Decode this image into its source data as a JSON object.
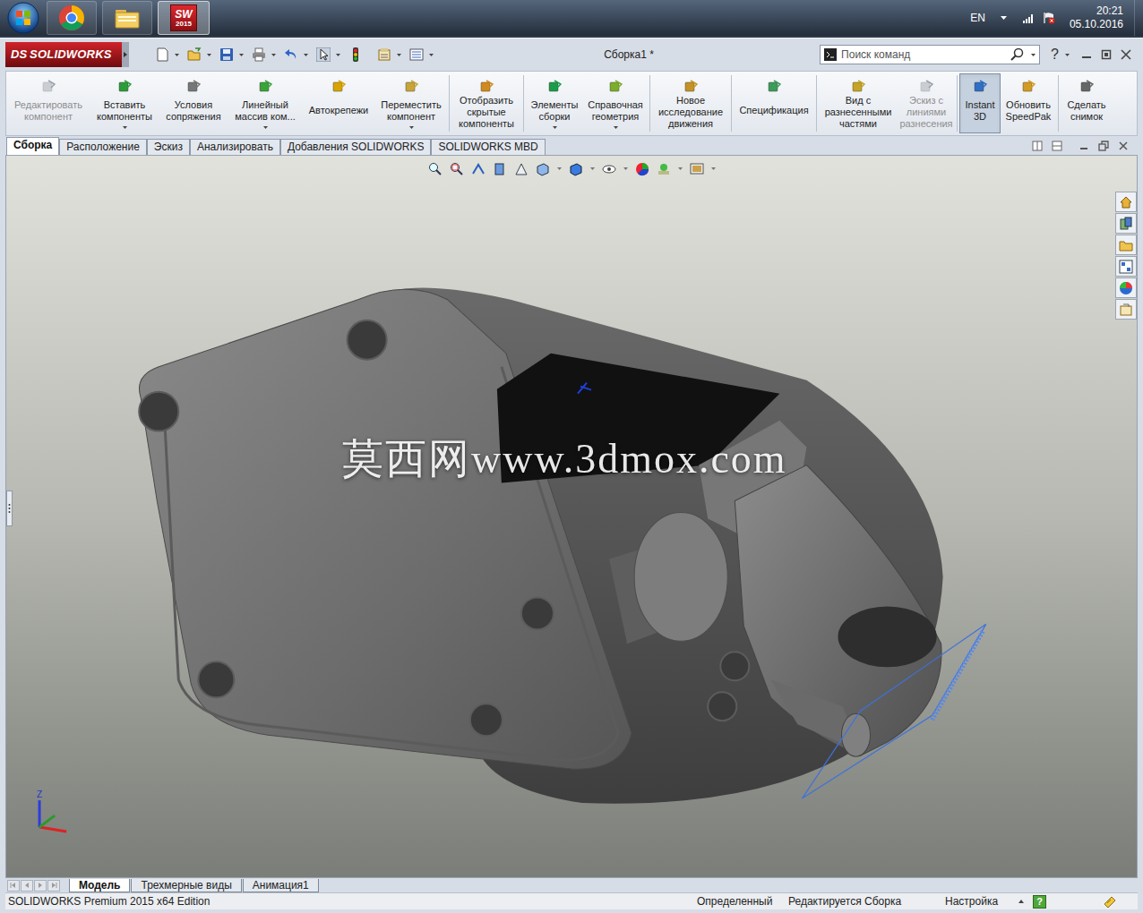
{
  "taskbar": {
    "sw_badge": "SW",
    "sw_version": "2015",
    "sw_active": true,
    "language": "EN",
    "time": "20:21",
    "date": "05.10.2016"
  },
  "window": {
    "logo_mark": "DS",
    "logo": "SOLIDWORKS",
    "title": "Сборка1 *",
    "search": {
      "placeholder": "Поиск команд"
    },
    "help": "?"
  },
  "ribbon": [
    {
      "label": "Редактировать\nкомпонент",
      "disabled": true,
      "selected": false,
      "dropdown": false
    },
    {
      "label": "Вставить\nкомпоненты",
      "disabled": false,
      "selected": false,
      "dropdown": true
    },
    {
      "label": "Условия\nсопряжения",
      "disabled": false,
      "selected": false,
      "dropdown": false
    },
    {
      "label": "Линейный\nмассив ком...",
      "disabled": false,
      "selected": false,
      "dropdown": true
    },
    {
      "label": "Автокрепежи",
      "disabled": false,
      "selected": false,
      "dropdown": false
    },
    {
      "label": "Переместить\nкомпонент",
      "disabled": false,
      "selected": false,
      "dropdown": true
    },
    {
      "label": "Отобразить\nскрытые\nкомпоненты",
      "disabled": false,
      "selected": false,
      "dropdown": false
    },
    {
      "label": "Элементы\nсборки",
      "disabled": false,
      "selected": false,
      "dropdown": true
    },
    {
      "label": "Справочная\nгеометрия",
      "disabled": false,
      "selected": false,
      "dropdown": true
    },
    {
      "label": "Новое\nисследование\nдвижения",
      "disabled": false,
      "selected": false,
      "dropdown": false
    },
    {
      "label": "Спецификация",
      "disabled": false,
      "selected": false,
      "dropdown": false
    },
    {
      "label": "Вид с\nразнесенными\nчастями",
      "disabled": false,
      "selected": false,
      "dropdown": false
    },
    {
      "label": "Эскиз с\nлиниями\nразнесения",
      "disabled": true,
      "selected": false,
      "dropdown": false
    },
    {
      "label": "Instant\n3D",
      "disabled": false,
      "selected": true,
      "dropdown": false
    },
    {
      "label": "Обновить\nSpeedPak",
      "disabled": false,
      "selected": false,
      "dropdown": false
    },
    {
      "label": "Сделать\nснимок",
      "disabled": false,
      "selected": false,
      "dropdown": false
    }
  ],
  "tabs": [
    {
      "label": "Сборка",
      "selected": true
    },
    {
      "label": "Расположение",
      "selected": false
    },
    {
      "label": "Эскиз",
      "selected": false
    },
    {
      "label": "Анализировать",
      "selected": false
    },
    {
      "label": "Добавления SOLIDWORKS",
      "selected": false
    },
    {
      "label": "SOLIDWORKS MBD",
      "selected": false
    }
  ],
  "viewport": {
    "watermark": "莫西网www.3dmox.com",
    "triad_label": "Z"
  },
  "bottom_tabs": [
    {
      "label": "Модель",
      "selected": true
    },
    {
      "label": "Трехмерные виды",
      "selected": false
    },
    {
      "label": "Анимация1",
      "selected": false
    }
  ],
  "status_bar": {
    "edition": "SOLIDWORKS Premium 2015 x64 Edition",
    "state": "Определенный",
    "mode": "Редактируется Сборка",
    "units": "Настройка",
    "help": "?"
  }
}
